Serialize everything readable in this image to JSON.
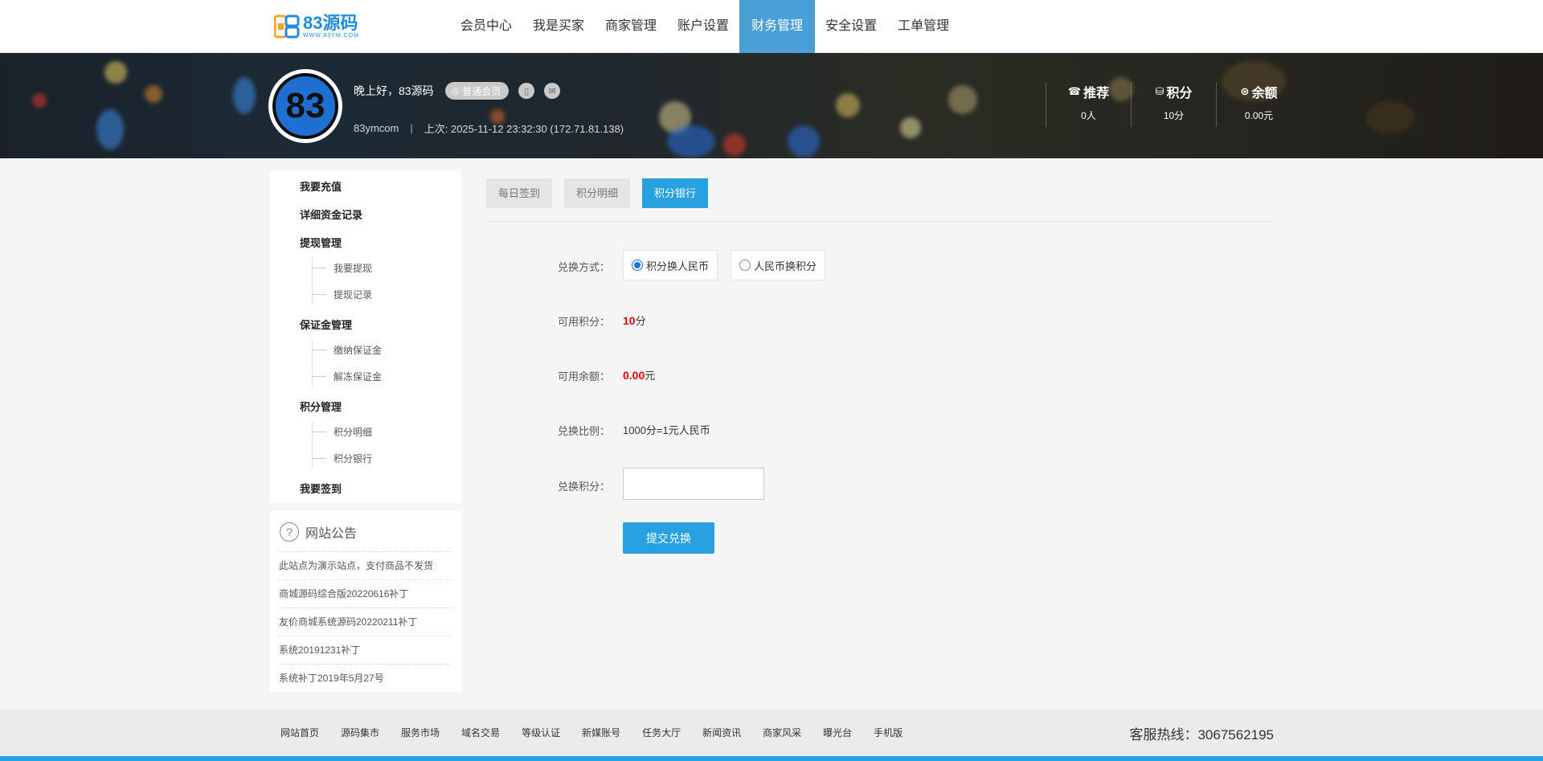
{
  "logo": {
    "brand": "83源码",
    "url": "WWW.83YM.COM"
  },
  "nav": [
    "会员中心",
    "我是买家",
    "商家管理",
    "账户设置",
    "财务管理",
    "安全设置",
    "工单管理"
  ],
  "nav_active_index": 4,
  "user": {
    "avatar_text": "83",
    "greeting": "晚上好，83源码",
    "member_level": "普通会员",
    "username": "83ymcom",
    "last_login": "上次: 2025-11-12 23:32:30 (172.71.81.138)"
  },
  "stats": [
    {
      "icon": "phone-icon",
      "glyph": "☎",
      "label": "推荐",
      "value": "0人"
    },
    {
      "icon": "coins-icon",
      "glyph": "⛁",
      "label": "积分",
      "value": "10分"
    },
    {
      "icon": "wallet-icon",
      "glyph": "⊛",
      "label": "余额",
      "value": "0.00元"
    }
  ],
  "sidebar": {
    "groups": [
      {
        "label": "我要充值",
        "children": []
      },
      {
        "label": "详细资金记录",
        "children": []
      },
      {
        "label": "提现管理",
        "children": [
          "我要提现",
          "提现记录"
        ]
      },
      {
        "label": "保证金管理",
        "children": [
          "缴纳保证金",
          "解冻保证金"
        ]
      },
      {
        "label": "积分管理",
        "children": [
          "积分明细",
          "积分银行"
        ]
      },
      {
        "label": "我要签到",
        "children": []
      }
    ]
  },
  "notice": {
    "title": "网站公告",
    "items": [
      "此站点为演示站点，支付商品不发货",
      "商城源码综合版20220616补丁",
      "友价商城系统源码20220211补丁",
      "系统20191231补丁",
      "系统补丁2019年5月27号"
    ]
  },
  "tabs": [
    "每日签到",
    "积分明细",
    "积分银行"
  ],
  "tabs_active_index": 2,
  "form": {
    "method_label": "兑换方式：",
    "methods": [
      "积分换人民币",
      "人民币换积分"
    ],
    "method_selected": 0,
    "points_label": "可用积分：",
    "points_value": "10",
    "points_unit": "分",
    "balance_label": "可用余额：",
    "balance_value": "0.00",
    "balance_unit": "元",
    "ratio_label": "兑换比例：",
    "ratio_value": "1000分=1元人民币",
    "exchange_label": "兑换积分：",
    "exchange_value": "",
    "submit_label": "提交兑换"
  },
  "footer": {
    "links": [
      "网站首页",
      "源码集市",
      "服务市场",
      "域名交易",
      "等级认证",
      "新媒账号",
      "任务大厅",
      "新闻资讯",
      "商家风采",
      "曝光台",
      "手机版"
    ],
    "hotline": "客服热线：3067562195"
  },
  "colors": {
    "accent": "#27a1df",
    "nav_active": "#4a9fd6",
    "highlight": "#e60012"
  }
}
